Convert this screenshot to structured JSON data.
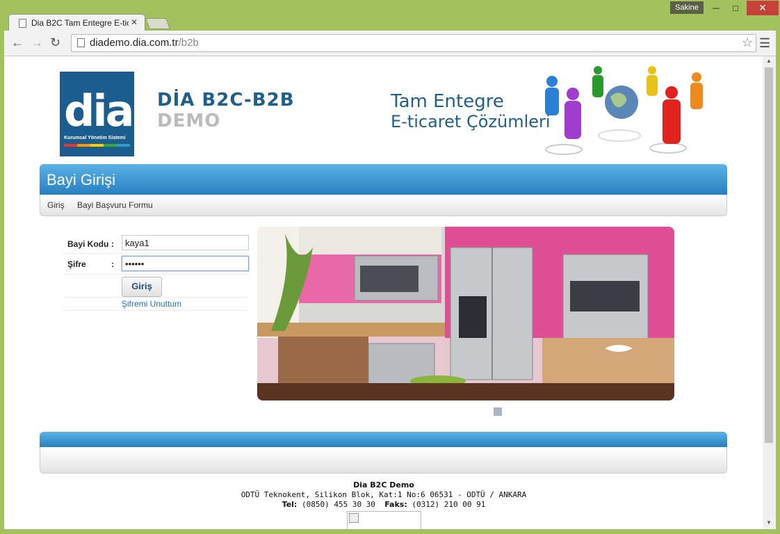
{
  "browser": {
    "user_badge": "Sakine",
    "tab_title": "Dia B2C Tam Entegre E-tic",
    "url_host": "diademo.dia.com.tr",
    "url_path": "/b2b"
  },
  "header": {
    "logo_text": "dia",
    "logo_sub": "Kurumsal Yönetim Sistemi",
    "brand": "DİA B2C-B2B",
    "brand_sub": "DEMO",
    "slogan_line1": "Tam Entegre",
    "slogan_line2": "E-ticaret Çözümleri"
  },
  "panel": {
    "title": "Bayi Girişi",
    "menu": [
      "Giriş",
      "Bayi Başvuru Formu"
    ]
  },
  "form": {
    "dealer_code_label": "Bayi Kodu",
    "dealer_code_value": "kaya1",
    "password_label": "Şifre",
    "password_value": "••••••",
    "colon": ":",
    "login_button": "Giriş",
    "forgot_link": "Şifremi Unuttum"
  },
  "footer": {
    "company": "Dia B2C Demo",
    "address": "ODTÜ Teknokent, Silikon Blok, Kat:1 No:6 06531 - ODTÜ / ANKARA",
    "tel_label": "Tel:",
    "tel": "(0850) 455 30 30",
    "fax_label": "Faks:",
    "fax": "(0312) 210 00 91"
  },
  "colors": {
    "frame": "#a3c15d",
    "panel_blue": "#2680c0",
    "brand_blue": "#1f5f8b",
    "close_red": "#c7413b"
  }
}
